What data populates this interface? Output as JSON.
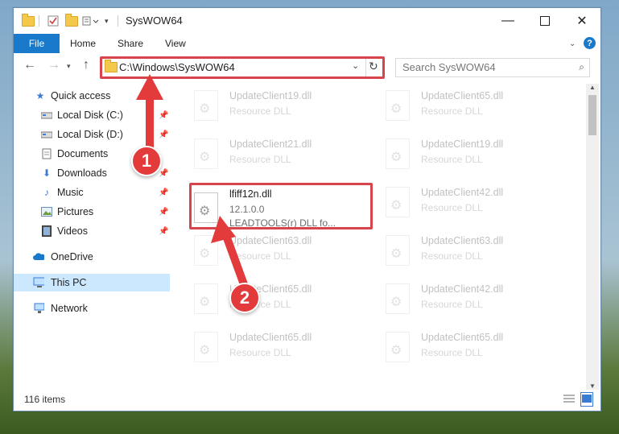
{
  "window": {
    "title": "SysWOW64"
  },
  "ribbon": {
    "tabs": [
      "File",
      "Home",
      "Share",
      "View"
    ]
  },
  "address": {
    "path": "C:\\Windows\\SysWOW64",
    "search_placeholder": "Search SysWOW64"
  },
  "sidebar": {
    "items": [
      {
        "label": "Quick access",
        "icon": "star-icon"
      },
      {
        "label": "Local Disk (C:)",
        "icon": "drive-icon"
      },
      {
        "label": "Local Disk (D:)",
        "icon": "drive-icon"
      },
      {
        "label": "Documents",
        "icon": "document-icon"
      },
      {
        "label": "Downloads",
        "icon": "download-icon"
      },
      {
        "label": "Music",
        "icon": "music-icon"
      },
      {
        "label": "Pictures",
        "icon": "pictures-icon"
      },
      {
        "label": "Videos",
        "icon": "videos-icon"
      },
      {
        "label": "OneDrive",
        "icon": "cloud-icon"
      },
      {
        "label": "This PC",
        "icon": "computer-icon"
      },
      {
        "label": "Network",
        "icon": "network-icon"
      }
    ]
  },
  "files": {
    "col1": [
      {
        "name": "UpdateClient19.dll",
        "sub": "Resource DLL"
      },
      {
        "name": "UpdateClient21.dll",
        "sub": "Resource DLL"
      },
      {
        "name": "lfiff12n.dll",
        "version": "12.1.0.0",
        "sub": "LEADTOOLS(r) DLL fo..."
      },
      {
        "name": "UpdateClient63.dll",
        "sub": "Resource DLL"
      },
      {
        "name": "UpdateClient65.dll",
        "sub": "Resource DLL"
      },
      {
        "name": "UpdateClient65.dll",
        "sub": "Resource DLL"
      }
    ],
    "col2": [
      {
        "name": "UpdateClient65.dll",
        "sub": "Resource DLL"
      },
      {
        "name": "UpdateClient19.dll",
        "sub": "Resource DLL"
      },
      {
        "name": "UpdateClient42.dll",
        "sub": "Resource DLL"
      },
      {
        "name": "UpdateClient63.dll",
        "sub": "Resource DLL"
      },
      {
        "name": "UpdateClient42.dll",
        "sub": "Resource DLL"
      },
      {
        "name": "UpdateClient65.dll",
        "sub": "Resource DLL"
      }
    ]
  },
  "status": {
    "count": "116 items"
  },
  "annotations": {
    "step1": "1",
    "step2": "2"
  },
  "colors": {
    "accent": "#1979ca",
    "highlight": "#d9444a",
    "selected": "#cce8ff"
  }
}
